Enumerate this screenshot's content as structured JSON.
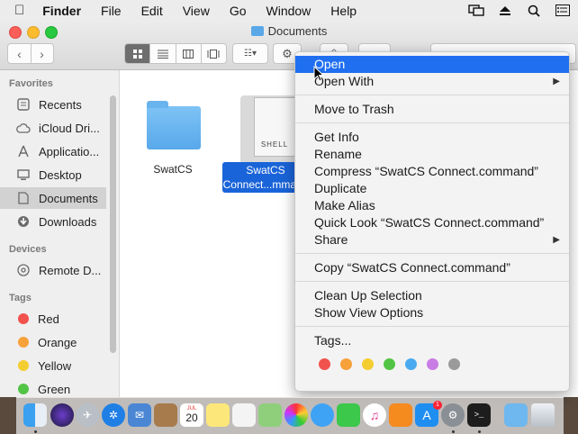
{
  "menubar": {
    "app": "Finder",
    "items": [
      "File",
      "Edit",
      "View",
      "Go",
      "Window",
      "Help"
    ]
  },
  "window": {
    "title": "Documents"
  },
  "sidebar": {
    "favorites_header": "Favorites",
    "favorites": [
      {
        "label": "Recents",
        "icon": "clock-icon"
      },
      {
        "label": "iCloud Dri...",
        "icon": "cloud-icon"
      },
      {
        "label": "Applicatio...",
        "icon": "applications-icon"
      },
      {
        "label": "Desktop",
        "icon": "desktop-icon"
      },
      {
        "label": "Documents",
        "icon": "document-icon"
      },
      {
        "label": "Downloads",
        "icon": "download-icon"
      }
    ],
    "devices_header": "Devices",
    "devices": [
      {
        "label": "Remote D...",
        "icon": "disk-icon"
      }
    ],
    "tags_header": "Tags",
    "tags": [
      {
        "label": "Red",
        "color": "#f2524d"
      },
      {
        "label": "Orange",
        "color": "#f7a13a"
      },
      {
        "label": "Yellow",
        "color": "#f4cd30"
      },
      {
        "label": "Green",
        "color": "#52c445"
      }
    ]
  },
  "files": {
    "folder": "SwatCS",
    "file_icon_text": "SHELL",
    "file_label_line1": "SwatCS",
    "file_label_line2": "Connect...mmand"
  },
  "context_menu": {
    "items": [
      "Open",
      "Open With",
      "Move to Trash",
      "Get Info",
      "Rename",
      "Compress “SwatCS Connect.command”",
      "Duplicate",
      "Make Alias",
      "Quick Look “SwatCS Connect.command”",
      "Share",
      "Copy “SwatCS Connect.command”",
      "Clean Up Selection",
      "Show View Options",
      "Tags..."
    ],
    "submenu_arrow": "▶",
    "highlight_color": "#1f6ff0",
    "tag_colors": [
      "#f2524d",
      "#f7a13a",
      "#f4cd30",
      "#52c445",
      "#4aaaf0",
      "#c97ce4",
      "#9a9a9a"
    ]
  },
  "dock": {
    "calendar_day": "20",
    "calendar_month": "JUL",
    "app_store_badge": "1"
  }
}
